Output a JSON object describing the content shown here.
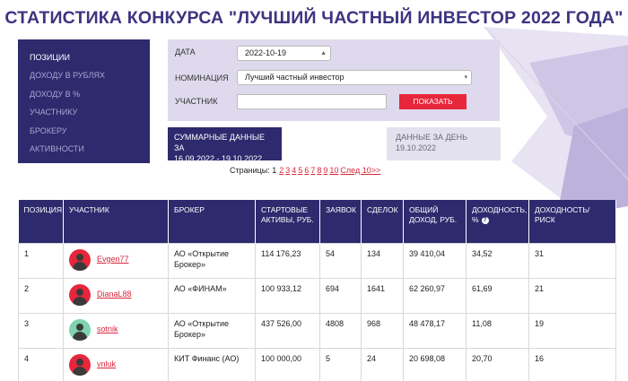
{
  "title": "СТАТИСТИКА КОНКУРСА \"ЛУЧШИЙ ЧАСТНЫЙ ИНВЕСТОР 2022 ГОДА\"",
  "sidemenu": {
    "items": [
      {
        "label": "позиции",
        "active": true
      },
      {
        "label": "доходу в рублях",
        "active": false
      },
      {
        "label": "доходу в %",
        "active": false
      },
      {
        "label": "участнику",
        "active": false
      },
      {
        "label": "брокеру",
        "active": false
      },
      {
        "label": "активности",
        "active": false
      }
    ]
  },
  "filters": {
    "date_label": "дата",
    "date_value": "2022-10-19",
    "nomination_label": "номинация",
    "nomination_value": "Лучший частный инвестор",
    "participant_label": "участник",
    "participant_value": "",
    "show_button": "показать"
  },
  "summary": {
    "label": "суммарные данные за",
    "period": "16.09.2022 - 19.10.2022"
  },
  "day_data": {
    "label": "данные за день",
    "date": "19.10.2022"
  },
  "pager": {
    "label": "Страницы: 1",
    "pages": [
      "2",
      "3",
      "4",
      "5",
      "6",
      "7",
      "8",
      "9",
      "10"
    ],
    "next": "След 10>>"
  },
  "table": {
    "headers": [
      "Позиция",
      "Участник",
      "Брокер",
      "Стартовые активы, руб.",
      "Заявок",
      "Сделок",
      "Общий доход, руб.",
      "Доходность, %",
      "Доходность/ риск"
    ],
    "rows": [
      {
        "position": "1",
        "name": "Evgen77",
        "broker": "АО «Открытие Брокер»",
        "assets": "114 176,23",
        "orders": "54",
        "deals": "134",
        "income": "39 410,04",
        "yield": "34,52",
        "risk": "31",
        "avatar_color": "#e8263b"
      },
      {
        "position": "2",
        "name": "DianaL88",
        "broker": "АО «ФИНАМ»",
        "assets": "100 933,12",
        "orders": "694",
        "deals": "1641",
        "income": "62 260,97",
        "yield": "61,69",
        "risk": "21",
        "avatar_color": "#e8263b"
      },
      {
        "position": "3",
        "name": "sotnik",
        "broker": "АО «Открытие Брокер»",
        "assets": "437 526,00",
        "orders": "4808",
        "deals": "968",
        "income": "48 478,17",
        "yield": "11,08",
        "risk": "19",
        "avatar_color": "#7fd3b0"
      },
      {
        "position": "4",
        "name": "vnluk",
        "broker": "КИТ Финанс (АО)",
        "assets": "100 000,00",
        "orders": "5",
        "deals": "24",
        "income": "20 698,08",
        "yield": "20,70",
        "risk": "16",
        "avatar_color": "#e8263b"
      }
    ]
  },
  "colors": {
    "primary": "#2e2a6e",
    "accent": "#e8263b",
    "panel": "#ded9ec"
  }
}
